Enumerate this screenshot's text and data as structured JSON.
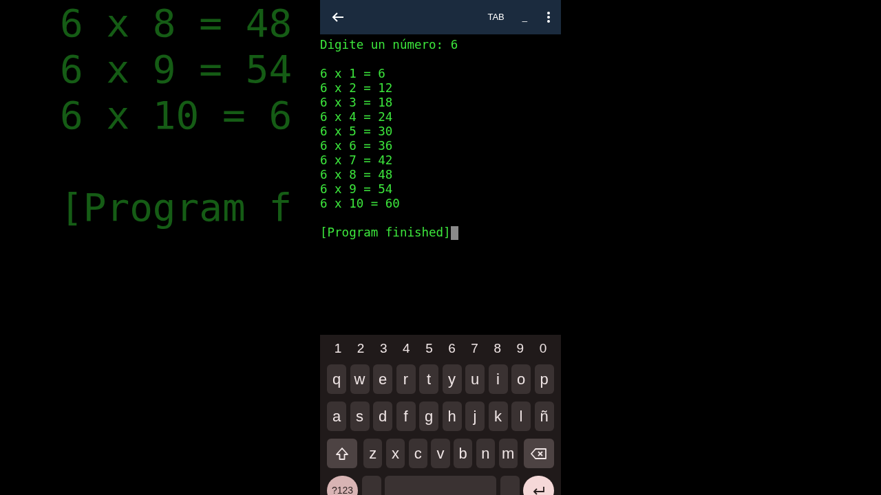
{
  "backdrop_blocks": [
    [
      "6 x 8 = 48",
      "6 x 9 = 54",
      "6 x 10 = 6"
    ],
    [
      "[Program f"
    ]
  ],
  "toolbar": {
    "extra_keys": [
      {
        "label": "TAB",
        "kind": "text"
      },
      {
        "label": "_",
        "kind": "text"
      }
    ]
  },
  "terminal": {
    "blocks": [
      [
        "Digite un número: 6"
      ],
      [
        "6 x 1 = 6",
        "6 x 2 = 12",
        "6 x 3 = 18",
        "6 x 4 = 24",
        "6 x 5 = 30",
        "6 x 6 = 36",
        "6 x 7 = 42",
        "6 x 8 = 48",
        "6 x 9 = 54",
        "6 x 10 = 60"
      ],
      [
        "[Program finished]"
      ]
    ],
    "cursor": true
  },
  "keyboard": {
    "digits": [
      "1",
      "2",
      "3",
      "4",
      "5",
      "6",
      "7",
      "8",
      "9",
      "0"
    ],
    "rows": [
      [
        {
          "kind": "char",
          "label": "q"
        },
        {
          "kind": "char",
          "label": "w"
        },
        {
          "kind": "char",
          "label": "e"
        },
        {
          "kind": "char",
          "label": "r"
        },
        {
          "kind": "char",
          "label": "t"
        },
        {
          "kind": "char",
          "label": "y"
        },
        {
          "kind": "char",
          "label": "u"
        },
        {
          "kind": "char",
          "label": "i"
        },
        {
          "kind": "char",
          "label": "o"
        },
        {
          "kind": "char",
          "label": "p"
        }
      ],
      [
        {
          "kind": "char",
          "label": "a"
        },
        {
          "kind": "char",
          "label": "s"
        },
        {
          "kind": "char",
          "label": "d"
        },
        {
          "kind": "char",
          "label": "f"
        },
        {
          "kind": "char",
          "label": "g"
        },
        {
          "kind": "char",
          "label": "h"
        },
        {
          "kind": "char",
          "label": "j"
        },
        {
          "kind": "char",
          "label": "k"
        },
        {
          "kind": "char",
          "label": "l"
        },
        {
          "kind": "char",
          "label": "ñ"
        }
      ],
      [
        {
          "kind": "shift"
        },
        {
          "kind": "char",
          "label": "z"
        },
        {
          "kind": "char",
          "label": "x"
        },
        {
          "kind": "char",
          "label": "c"
        },
        {
          "kind": "char",
          "label": "v"
        },
        {
          "kind": "char",
          "label": "b"
        },
        {
          "kind": "char",
          "label": "n"
        },
        {
          "kind": "char",
          "label": "m"
        },
        {
          "kind": "backspace"
        }
      ],
      [
        {
          "kind": "symbols",
          "label": "?123"
        },
        {
          "kind": "small"
        },
        {
          "kind": "space"
        },
        {
          "kind": "small"
        },
        {
          "kind": "enter"
        }
      ]
    ]
  }
}
